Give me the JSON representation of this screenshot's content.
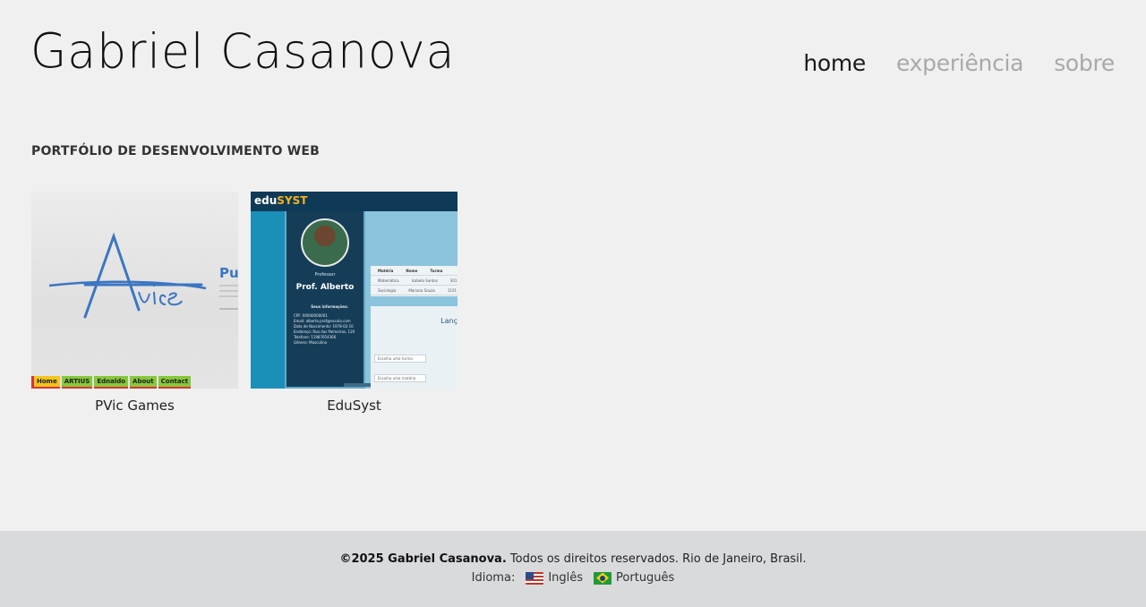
{
  "header": {
    "title": "Gabriel Casanova",
    "nav": [
      {
        "label": "home",
        "active": true
      },
      {
        "label": "experiência",
        "active": false
      },
      {
        "label": "sobre",
        "active": false
      }
    ]
  },
  "main": {
    "section_title": "PORTFÓLIO DE DESENVOLVIMENTO WEB",
    "projects": [
      {
        "caption": "PVic Games",
        "thumb": {
          "heading_fragment": "Pu",
          "menu": [
            "Home",
            "ARTIUS",
            "Ednaldo",
            "About",
            "Contact"
          ]
        }
      },
      {
        "caption": "EduSyst",
        "thumb": {
          "logo_a": "edu",
          "logo_b": "SYST",
          "role": "Professor",
          "name": "Prof. Alberto",
          "info_heading": "Seus informações:",
          "info_lines": [
            "CPF: 00000000001",
            "Email: alberto.prof@escola.com",
            "Data de Nascimento: 1978-02-10",
            "Endereço: Rua das Palmeiras, 120",
            "Telefone: 11987654366",
            "Gênero: Masculino"
          ],
          "table_head": [
            "Matéria",
            "Nome",
            "Turma"
          ],
          "table_rows": [
            [
              "Matemática",
              "Isabela Santos",
              "301"
            ],
            [
              "Sociologia",
              "Mariana Souza",
              "1101"
            ]
          ],
          "section": "Lanç",
          "selects": [
            "Escolha uma turma",
            "Escolha uma matéria"
          ]
        }
      }
    ]
  },
  "footer": {
    "copyright_bold": "©2025 Gabriel Casanova.",
    "copyright_rest": "Todos os direitos reservados. Rio de Janeiro, Brasil.",
    "language_label": "Idioma:",
    "languages": [
      {
        "label": "Inglês",
        "flag": "us-flag"
      },
      {
        "label": "Português",
        "flag": "br-flag"
      }
    ]
  },
  "colors": {
    "background": "#f0f0f0",
    "footer_bg": "#d9dadc",
    "nav_inactive": "#a9a9a9",
    "nav_active": "#1a1a1a",
    "pvic_logo_blue": "#3b76c2",
    "edusyst_navy": "#0f3a57"
  }
}
